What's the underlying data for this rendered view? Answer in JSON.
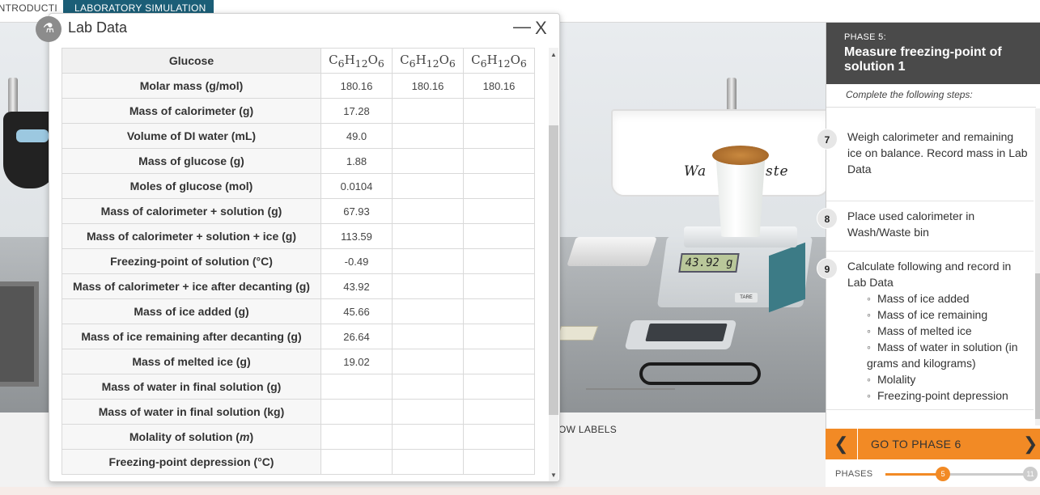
{
  "tabs": {
    "introduction": "INTRODUCTION",
    "lab_simulation": "LABORATORY SIMULATION"
  },
  "scene": {
    "bin_label_left": "Wa",
    "bin_label_right": "ste",
    "balance_display": "43.92 g",
    "tare_label": "TARE",
    "show_labels": "OW LABELS"
  },
  "lab_data": {
    "title": "Lab Data",
    "minimize_label": "—",
    "close_label": "X",
    "header": {
      "label": "Glucose",
      "col1": "C6H12O6",
      "col2": "C6H12O6",
      "col3": "C6H12O6"
    },
    "rows": [
      {
        "label": "Molar mass (g/mol)",
        "v1": "180.16",
        "v2": "180.16",
        "v3": "180.16"
      },
      {
        "label": "Mass of calorimeter (g)",
        "v1": "17.28",
        "v2": "",
        "v3": ""
      },
      {
        "label": "Volume of DI water (mL)",
        "v1": "49.0",
        "v2": "",
        "v3": ""
      },
      {
        "label": "Mass of glucose (g)",
        "v1": "1.88",
        "v2": "",
        "v3": ""
      },
      {
        "label": "Moles of glucose (mol)",
        "v1": "0.0104",
        "v2": "",
        "v3": ""
      },
      {
        "label": "Mass of calorimeter + solution (g)",
        "v1": "67.93",
        "v2": "",
        "v3": ""
      },
      {
        "label": "Mass of calorimeter + solution + ice (g)",
        "v1": "113.59",
        "v2": "",
        "v3": ""
      },
      {
        "label": "Freezing-point of solution (°C)",
        "v1": "-0.49",
        "v2": "",
        "v3": ""
      },
      {
        "label": "Mass of calorimeter + ice after decanting (g)",
        "v1": "43.92",
        "v2": "",
        "v3": ""
      },
      {
        "label": "Mass of ice added (g)",
        "v1": "45.66",
        "v2": "",
        "v3": ""
      },
      {
        "label": "Mass of ice remaining after decanting (g)",
        "v1": "26.64",
        "v2": "",
        "v3": ""
      },
      {
        "label": "Mass of melted ice (g)",
        "v1": "19.02",
        "v2": "",
        "v3": ""
      },
      {
        "label": "Mass of water in final solution (g)",
        "v1": "",
        "v2": "",
        "v3": ""
      },
      {
        "label": "Mass of water in final solution (kg)",
        "v1": "",
        "v2": "",
        "v3": ""
      },
      {
        "label": "Molality of solution (m)",
        "v1": "",
        "v2": "",
        "v3": ""
      },
      {
        "label": "Freezing-point depression (°C)",
        "v1": "",
        "v2": "",
        "v3": ""
      }
    ]
  },
  "phase": {
    "label": "PHASE 5:",
    "title": "Measure freezing-point of solution 1",
    "intro": "Complete the following steps:",
    "steps": [
      {
        "num": "7",
        "text": "Weigh calorimeter and remaining ice on balance. Record mass in Lab Data"
      },
      {
        "num": "8",
        "text": "Place used calorimeter in Wash/Waste bin"
      },
      {
        "num": "9",
        "text": "Calculate following and record in Lab Data",
        "bullets": [
          "Mass of ice added",
          "Mass of ice remaining",
          "Mass of melted ice",
          "Mass of water in solution (in grams and kilograms)",
          "Molality",
          "Freezing-point depression"
        ]
      }
    ]
  },
  "navigation": {
    "go_to_label": "GO TO PHASE 6",
    "prev_icon": "chevron-left-icon",
    "next_icon": "chevron-right-icon",
    "phases_label": "PHASES",
    "current_phase": "5",
    "last_phase": "11",
    "progress_fraction": 0.4
  },
  "colors": {
    "accent": "#f28a25",
    "tab_active": "#1b5e77",
    "phase_header": "#4a4a4a"
  }
}
